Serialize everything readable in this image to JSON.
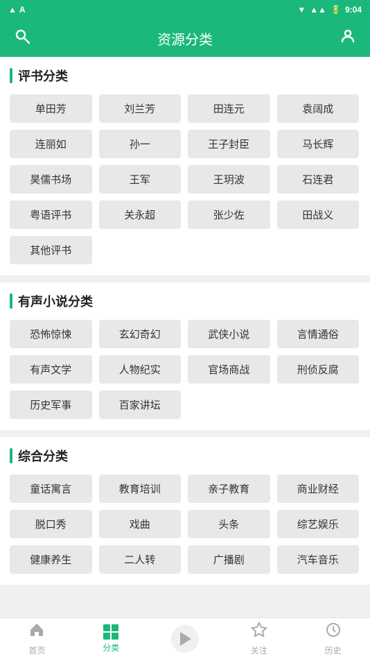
{
  "statusBar": {
    "time": "9:04",
    "batteryIcon": "🔋",
    "signalIcon": "▲"
  },
  "header": {
    "title": "资源分类",
    "searchLabel": "搜索",
    "userLabel": "用户"
  },
  "sections": [
    {
      "id": "pingshufenlei",
      "title": "评书分类",
      "tags": [
        "单田芳",
        "刘兰芳",
        "田连元",
        "袁阔成",
        "连丽如",
        "孙一",
        "王子封臣",
        "马长辉",
        "昊儒书场",
        "王军",
        "王玥波",
        "石连君",
        "粤语评书",
        "关永超",
        "张少佐",
        "田战义",
        "其他评书"
      ]
    },
    {
      "id": "youshengxiaoshuofenlei",
      "title": "有声小说分类",
      "tags": [
        "恐怖惊悚",
        "玄幻奇幻",
        "武侠小说",
        "言情通俗",
        "有声文学",
        "人物纪实",
        "官场商战",
        "刑侦反腐",
        "历史军事",
        "百家讲坛"
      ]
    },
    {
      "id": "zonghefenlei",
      "title": "综合分类",
      "tags": [
        "童话寓言",
        "教育培训",
        "亲子教育",
        "商业财经",
        "脱口秀",
        "戏曲",
        "头条",
        "综艺娱乐",
        "健康养生",
        "二人转",
        "广播剧",
        "汽车音乐"
      ]
    }
  ],
  "bottomNav": [
    {
      "id": "home",
      "label": "首页",
      "active": false
    },
    {
      "id": "category",
      "label": "分类",
      "active": true
    },
    {
      "id": "play",
      "label": "",
      "active": false
    },
    {
      "id": "follow",
      "label": "关注",
      "active": false
    },
    {
      "id": "history",
      "label": "历史",
      "active": false
    }
  ]
}
